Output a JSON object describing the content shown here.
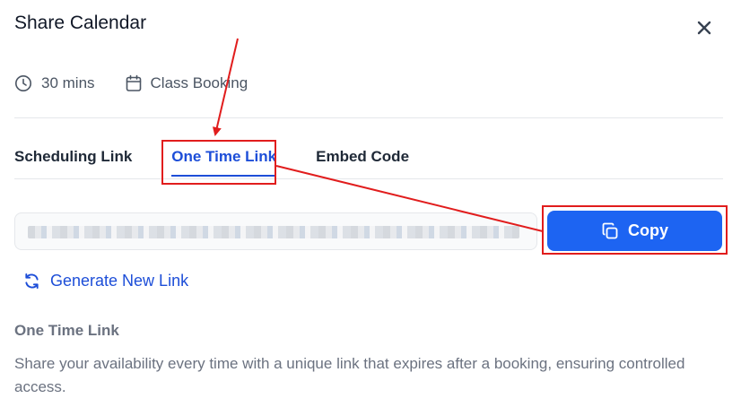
{
  "dialog": {
    "title": "Share Calendar"
  },
  "meta": {
    "duration": "30 mins",
    "event_name": "Class Booking"
  },
  "tabs": [
    {
      "label": "Scheduling Link",
      "active": false
    },
    {
      "label": "One Time Link",
      "active": true
    },
    {
      "label": "Embed Code",
      "active": false
    }
  ],
  "link_field": {
    "value": ""
  },
  "copy_button": {
    "label": "Copy"
  },
  "generate_link": {
    "label": "Generate New Link"
  },
  "info": {
    "title": "One Time Link",
    "description": "Share your availability every time with a unique link that expires after a booking, ensuring controlled access."
  },
  "colors": {
    "primary": "#1d64f2",
    "link": "#1d4ed8",
    "annotation": "#e11d1d"
  }
}
